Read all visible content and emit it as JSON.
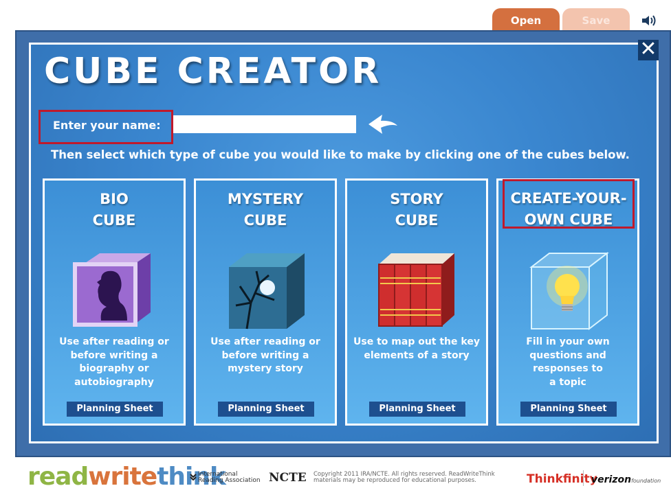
{
  "toolbar": {
    "open_label": "Open",
    "save_label": "Save"
  },
  "app": {
    "title": "CUBE CREATOR",
    "close_label": "✕"
  },
  "form": {
    "name_label": "Enter your name:",
    "name_value": "",
    "name_placeholder": ""
  },
  "instruction": "Then select which type of cube you would like to make by clicking one of the cubes below.",
  "cards": [
    {
      "line1": "BIO",
      "line2": "CUBE",
      "desc": [
        "Use after reading or",
        "before writing a",
        "biography or",
        "autobiography"
      ],
      "plan": "Planning Sheet",
      "icon": "silhouette-portrait-cube-icon"
    },
    {
      "line1": "MYSTERY",
      "line2": "CUBE",
      "desc": [
        "Use after reading or",
        "before writing a",
        "mystery story"
      ],
      "plan": "Planning Sheet",
      "icon": "moonlit-tree-cube-icon"
    },
    {
      "line1": "STORY",
      "line2": "CUBE",
      "desc": [
        "Use to map out the key",
        "elements of a story"
      ],
      "plan": "Planning Sheet",
      "icon": "books-icon"
    },
    {
      "line1": "CREATE-YOUR-",
      "line2": "OWN CUBE",
      "desc": [
        "Fill in your own",
        "questions and",
        "responses to",
        "a topic"
      ],
      "plan": "Planning Sheet",
      "icon": "lightbulb-cube-icon"
    }
  ],
  "footer": {
    "logo": {
      "read": "read",
      "write": "write",
      "think": "think"
    },
    "ira_line1": "International",
    "ira_line2": "Reading Association",
    "ncte": "NCTE",
    "copyright_line1": "Copyright 2011 IRA/NCTE. All rights reserved. ReadWriteThink",
    "copyright_line2": "materials may be reproduced for educational purposes.",
    "thinkfinity": "Thinkfinity",
    "verizon": "verizon",
    "verizon_foundation": "foundation"
  },
  "colors": {
    "frame": "#3f6ea9",
    "panel": "#3a86cf",
    "highlight": "#c0192b",
    "open_tab": "#d4703f",
    "save_tab": "#f3c4ae"
  }
}
